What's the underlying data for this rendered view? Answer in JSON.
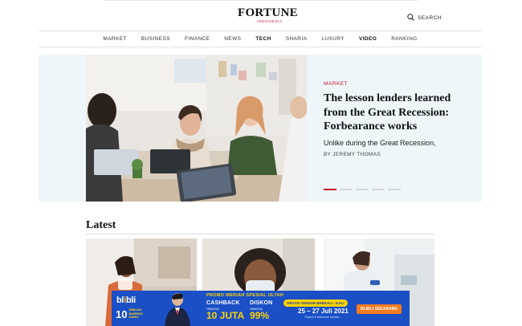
{
  "header": {
    "logo_main": "FORTUNE",
    "logo_sub": "INDONESIA",
    "search_label": "SEARCH",
    "search_icon": "search-icon"
  },
  "nav": {
    "items": [
      {
        "label": "MARKET"
      },
      {
        "label": "BUSINESS"
      },
      {
        "label": "FINANCE"
      },
      {
        "label": "NEWS"
      },
      {
        "label": "TECH"
      },
      {
        "label": "SHARIA"
      },
      {
        "label": "LUXURY"
      },
      {
        "label": "VIDEO"
      },
      {
        "label": "RANKING"
      }
    ]
  },
  "hero": {
    "category": "MARKET",
    "title": "The lesson lenders learned from the Great Recession: Forbearance works",
    "subtitle": "Unlike during the Great Recession,",
    "byline_prefix": "BY",
    "author": "JEREMY THOMAS",
    "slide_count": 5,
    "active_slide": 1
  },
  "latest": {
    "title": "Latest"
  },
  "ad": {
    "brand_a": "bl",
    "brand_i": "i",
    "brand_b": "bli",
    "badge_num": "10",
    "badge_text_1": "RIBUAN",
    "badge_text_2": "BARENG",
    "badge_text_3": "KAMU",
    "headline": "PROMO MERIAH SPESIAL ULTAH",
    "cashback_label": "CASHBACK",
    "cashback_sub": "HINGGA",
    "cashback_value": "10 JUTA",
    "diskon_label": "DISKON",
    "diskon_sub": "HINGGA",
    "diskon_value": "99%",
    "gratis": "GRATIS ONGKIR BERKALI - KALI",
    "date": "25 – 27 Juli 2021",
    "terms": "*Syarat & ketentuan berlaku",
    "cta": "BLIBLI SEKARANG"
  },
  "colors": {
    "accent_red": "#c8102e",
    "hero_bg": "#eef6f9",
    "ad_blue": "#1a4fc6",
    "ad_yellow": "#ffd400"
  }
}
